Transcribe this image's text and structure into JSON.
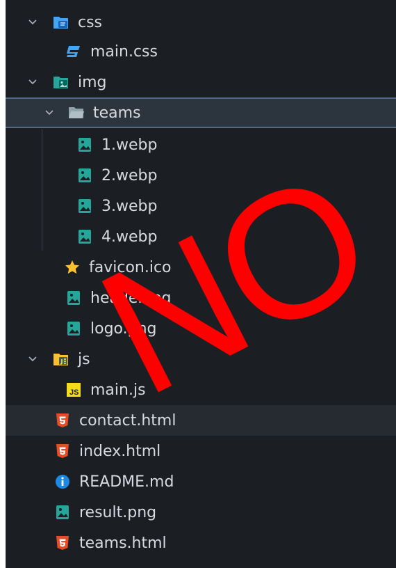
{
  "tree": {
    "items": [
      {
        "label": "css"
      },
      {
        "label": "main.css"
      },
      {
        "label": "img"
      },
      {
        "label": "teams"
      },
      {
        "label": "1.webp"
      },
      {
        "label": "2.webp"
      },
      {
        "label": "3.webp"
      },
      {
        "label": "4.webp"
      },
      {
        "label": "favicon.ico"
      },
      {
        "label": "header.jpg"
      },
      {
        "label": "logo.png"
      },
      {
        "label": "js"
      },
      {
        "label": "main.js"
      },
      {
        "label": "contact.html"
      },
      {
        "label": "index.html"
      },
      {
        "label": "README.md"
      },
      {
        "label": "result.png"
      },
      {
        "label": "teams.html"
      }
    ]
  },
  "overlay": {
    "text": "NO"
  },
  "icons": {
    "css-folder": "folder-css-icon",
    "css-file": "css-file-icon",
    "img-folder": "folder-images-icon",
    "plain-folder": "folder-open-icon",
    "image-file": "image-file-icon",
    "favicon": "star-icon",
    "js-folder": "folder-js-icon",
    "js-file": "js-file-icon",
    "html-file": "html-file-icon",
    "readme": "info-icon"
  },
  "colors": {
    "background": "#1b1f23",
    "selected": "#2c343e",
    "text": "#d7dbe0",
    "html": "#e44d26",
    "css": "#42a5f5",
    "image": "#26a69a",
    "js": "#f5de19",
    "info": "#1e88e5",
    "overlay": "#ff0000"
  }
}
